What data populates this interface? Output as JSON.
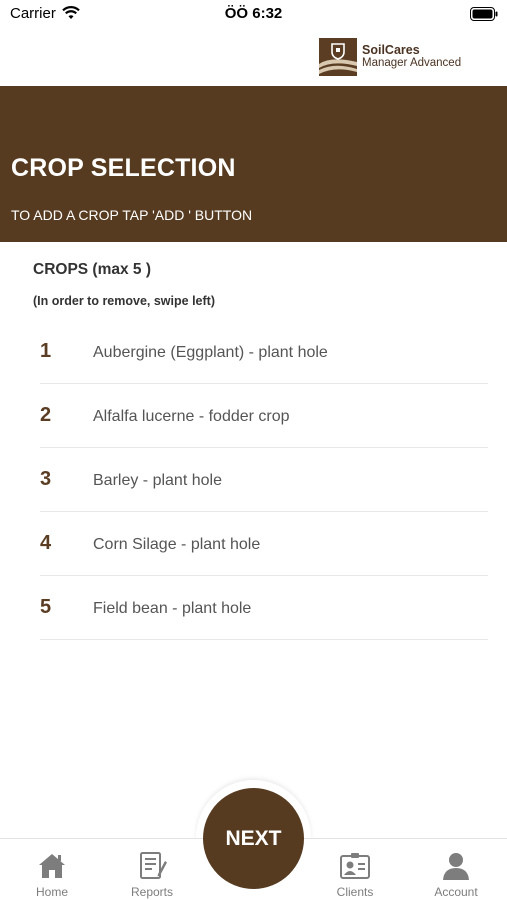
{
  "status_bar": {
    "carrier": "Carrier",
    "time": "ÖÖ 6:32"
  },
  "brand": {
    "name": "SoilCares",
    "subtitle": "Manager Advanced"
  },
  "banner": {
    "title": "CROP SELECTION",
    "subtitle": "TO ADD A CROP TAP 'ADD ' BUTTON"
  },
  "crops": {
    "heading": "CROPS (max  5 )",
    "hint": "(In order to remove, swipe left)",
    "items": [
      {
        "number": "1",
        "name": "Aubergine (Eggplant) - plant hole"
      },
      {
        "number": "2",
        "name": "Alfalfa lucerne - fodder crop"
      },
      {
        "number": "3",
        "name": "Barley - plant hole"
      },
      {
        "number": "4",
        "name": "Corn Silage - plant hole"
      },
      {
        "number": "5",
        "name": "Field bean - plant hole"
      }
    ]
  },
  "next_label": "NEXT",
  "tabs": [
    {
      "label": "Home",
      "icon": "home-icon"
    },
    {
      "label": "Reports",
      "icon": "reports-icon"
    },
    {
      "label": "Clients",
      "icon": "clients-icon"
    },
    {
      "label": "Account",
      "icon": "account-icon"
    }
  ],
  "colors": {
    "brand_brown": "#573b21",
    "tab_gray": "#7d7d7d"
  }
}
